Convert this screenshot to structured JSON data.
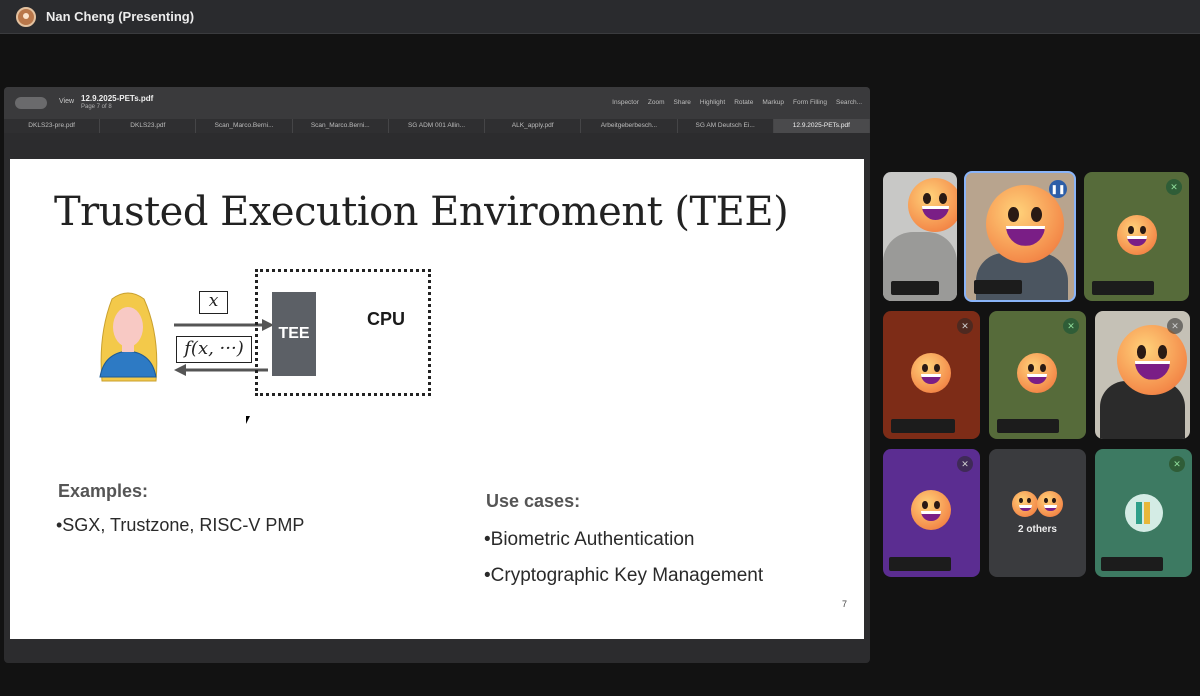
{
  "meeting": {
    "presenter_label": "Nan Cheng (Presenting)"
  },
  "pdf_viewer": {
    "view_label": "View",
    "doc_title": "12.9.2025-PETs.pdf",
    "page_indicator": "Page 7 of 8",
    "tools": [
      "Inspector",
      "Zoom",
      "Share",
      "Highlight",
      "Rotate",
      "Markup",
      "Form Filling",
      "Search..."
    ],
    "tabs": [
      "DKLS23-pre.pdf",
      "DKLS23.pdf",
      "Scan_Marco.Berni...",
      "Scan_Marco.Berni...",
      "SG ADM 001 Allin...",
      "ALK_apply.pdf",
      "Arbeitgeberbesch...",
      "SG AM Deutsch Ei...",
      "12.9.2025-PETs.pdf"
    ],
    "active_tab_index": 8
  },
  "slide": {
    "title": "Trusted Execution Enviroment (TEE)",
    "diagram": {
      "input_label": "x",
      "output_label": "f(x, ···)",
      "tee_label": "TEE",
      "cpu_label": "CPU"
    },
    "examples_heading": "Examples:",
    "examples_item": "•SGX, Trustzone, RISC-V PMP",
    "use_cases_heading": "Use cases:",
    "use_case_1": "•Biometric Authentication",
    "use_case_2": "•Cryptographic Key Management",
    "page_number": "7"
  },
  "participants": {
    "others_label": "2 others",
    "colors": {
      "green": "#566b3a",
      "red": "#7d2c17",
      "purple": "#5b2d91",
      "gray": "#3a3b3e",
      "teal": "#3d7a62",
      "speaking_border": "#8ab4f8"
    }
  }
}
